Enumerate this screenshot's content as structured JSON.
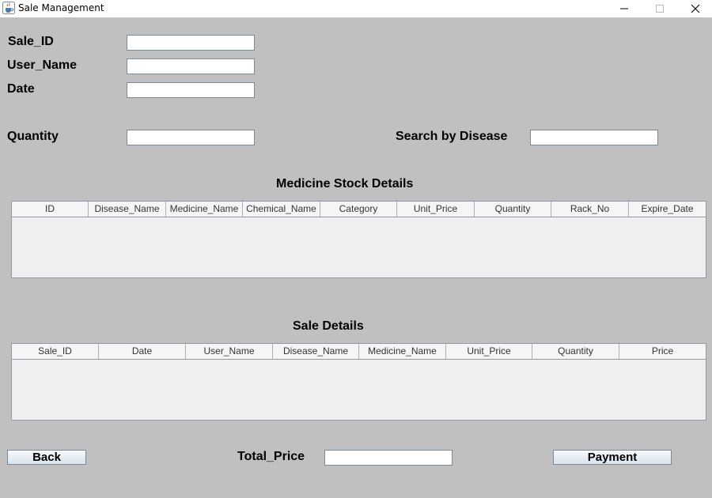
{
  "window": {
    "title": "Sale Management",
    "icon": "java-cup-icon"
  },
  "form": {
    "sale_id_label": "Sale_ID",
    "user_name_label": "User_Name",
    "date_label": "Date",
    "quantity_label": "Quantity",
    "search_label": "Search by Disease",
    "sale_id_value": "",
    "user_name_value": "",
    "date_value": "",
    "quantity_value": "",
    "search_value": ""
  },
  "stock_table": {
    "title": "Medicine Stock Details",
    "columns": [
      "ID",
      "Disease_Name",
      "Medicine_Name",
      "Chemical_Name",
      "Category",
      "Unit_Price",
      "Quantity",
      "Rack_No",
      "Expire_Date"
    ],
    "rows": []
  },
  "sale_table": {
    "title": "Sale Details",
    "columns": [
      "Sale_ID",
      "Date",
      "User_Name",
      "Disease_Name",
      "Medicine_Name",
      "Unit_Price",
      "Quantity",
      "Price"
    ],
    "rows": []
  },
  "footer": {
    "back_label": "Back",
    "total_label": "Total_Price",
    "total_value": "",
    "payment_label": "Payment"
  }
}
